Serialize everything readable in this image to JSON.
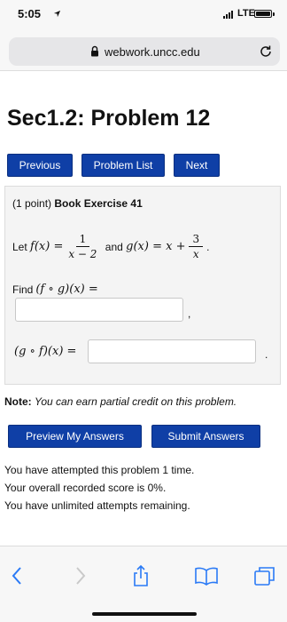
{
  "status_bar": {
    "time": "5:05",
    "network": "LTE",
    "icons": [
      "location-arrow-icon",
      "signal-icon",
      "battery-icon"
    ]
  },
  "browser": {
    "url": "webwork.uncc.edu",
    "icons": [
      "lock-icon",
      "reload-icon"
    ]
  },
  "page": {
    "title": "Sec1.2: Problem 12",
    "nav": {
      "previous": "Previous",
      "problem_list": "Problem List",
      "next": "Next"
    }
  },
  "problem": {
    "points": "(1 point)",
    "exercise": "Book Exercise 41",
    "let_text": "Let",
    "f_lhs": "f(x) =",
    "f_num": "1",
    "f_den": "x − 2",
    "and_text": "and",
    "g_lhs": "g(x) = x +",
    "g_num": "3",
    "g_den": "x",
    "g_period": ".",
    "find_text": "Find",
    "fog_expr": "(f ∘ g)(x) =",
    "answer1_value": "",
    "comma": ",",
    "gof_expr": "(g ∘ f)(x) =",
    "answer2_value": "",
    "period": "."
  },
  "note": {
    "label": "Note:",
    "text": "You can earn partial credit on this problem."
  },
  "actions": {
    "preview": "Preview My Answers",
    "submit": "Submit Answers"
  },
  "attempts": {
    "line1": "You have attempted this problem 1 time.",
    "line2": "Your overall recorded score is 0%.",
    "line3": "You have unlimited attempts remaining."
  },
  "toolbar": {
    "icons": [
      "back-icon",
      "forward-icon",
      "share-icon",
      "bookmarks-icon",
      "tabs-icon"
    ]
  },
  "colors": {
    "button_blue": "#0f3fa6",
    "safari_blue": "#2a7af6",
    "problem_bg": "#f4f4f4"
  }
}
